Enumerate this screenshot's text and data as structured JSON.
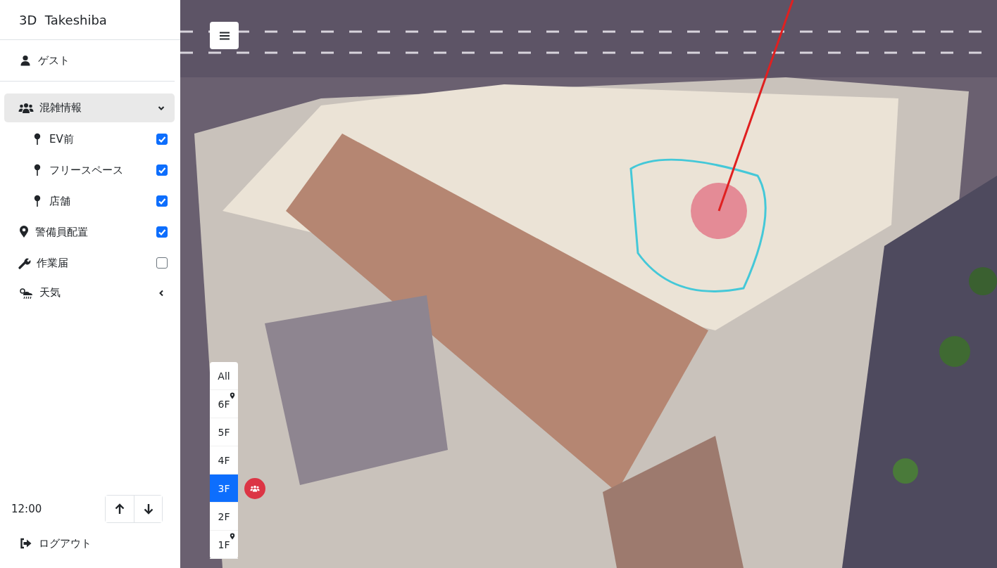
{
  "app": {
    "title": "3D  Takeshiba"
  },
  "user": {
    "name": "ゲスト"
  },
  "menu": [
    {
      "kind": "group",
      "label": "混雑情報",
      "expanded": true,
      "children": [
        {
          "kind": "check",
          "label": "EV前",
          "checked": true
        },
        {
          "kind": "check",
          "label": "フリースペース",
          "checked": true
        },
        {
          "kind": "check",
          "label": "店舗",
          "checked": true
        }
      ]
    },
    {
      "kind": "check",
      "label": "警備員配置",
      "checked": true
    },
    {
      "kind": "check",
      "label": "作業届",
      "checked": false
    },
    {
      "kind": "group",
      "label": "天気",
      "expanded": false
    }
  ],
  "time": {
    "label": "12:00"
  },
  "logout": {
    "label": "ログアウト"
  },
  "floors": [
    {
      "label": "All",
      "selected": false,
      "pin": false,
      "badge": false
    },
    {
      "label": "6F",
      "selected": false,
      "pin": true,
      "badge": false
    },
    {
      "label": "5F",
      "selected": false,
      "pin": false,
      "badge": false
    },
    {
      "label": "4F",
      "selected": false,
      "pin": false,
      "badge": false
    },
    {
      "label": "3F",
      "selected": true,
      "pin": false,
      "badge": true
    },
    {
      "label": "2F",
      "selected": false,
      "pin": false,
      "badge": false
    },
    {
      "label": "1F",
      "selected": false,
      "pin": true,
      "badge": false
    }
  ]
}
